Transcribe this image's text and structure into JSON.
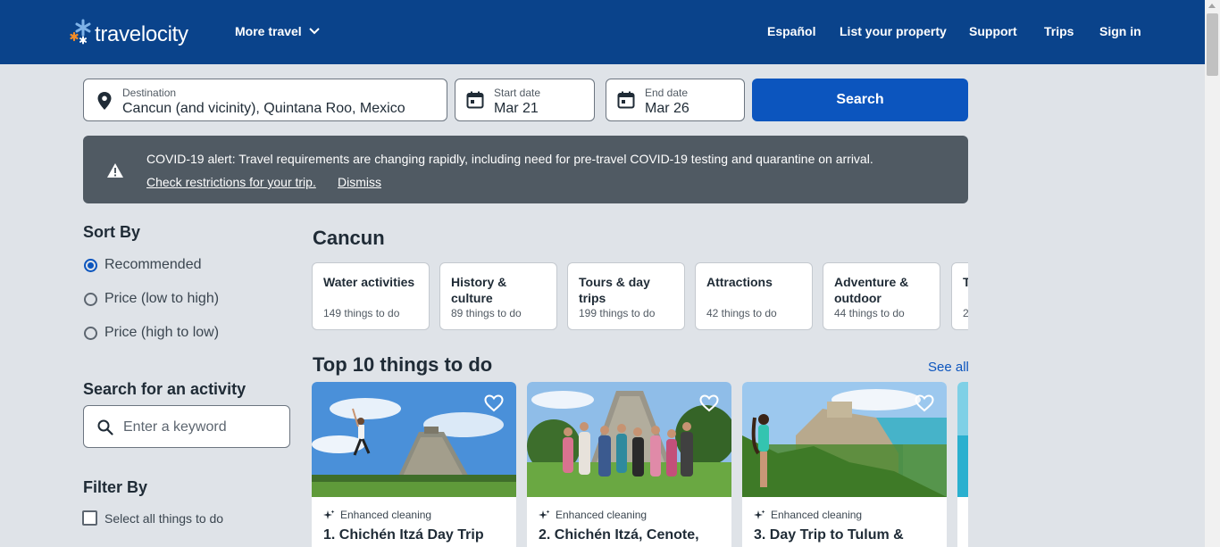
{
  "header": {
    "brand": "travelocity",
    "more_travel": "More travel",
    "links": [
      "Español",
      "List your property",
      "Support",
      "Trips",
      "Sign in"
    ]
  },
  "search": {
    "destination_label": "Destination",
    "destination_value": "Cancun (and vicinity), Quintana Roo, Mexico",
    "start_label": "Start date",
    "start_value": "Mar 21",
    "end_label": "End date",
    "end_value": "Mar 26",
    "button": "Search"
  },
  "alert": {
    "text": "COVID-19 alert: Travel requirements are changing rapidly, including need for pre-travel COVID-19 testing and quarantine on arrival.",
    "check_link": "Check restrictions for your trip.",
    "dismiss": "Dismiss"
  },
  "sidebar": {
    "sort_heading": "Sort By",
    "sort_options": [
      "Recommended",
      "Price (low to high)",
      "Price (high to low)"
    ],
    "sort_selected": "Recommended",
    "search_heading": "Search for an activity",
    "keyword_placeholder": "Enter a keyword",
    "filter_heading": "Filter By",
    "select_all": "Select all things to do"
  },
  "main": {
    "city": "Cancun",
    "categories": [
      {
        "name": "Water activities",
        "count": "149 things to do"
      },
      {
        "name": "History & culture",
        "count": "89 things to do"
      },
      {
        "name": "Tours & day trips",
        "count": "199 things to do"
      },
      {
        "name": "Attractions",
        "count": "42 things to do"
      },
      {
        "name": "Adventure & outdoor",
        "count": "44 things to do"
      },
      {
        "name": "T",
        "count": "2"
      }
    ],
    "top_heading": "Top 10 things to do",
    "see_all": "See all",
    "activities": [
      {
        "badge": "Enhanced cleaning",
        "title": "1. Chichén Itzá Day Trip"
      },
      {
        "badge": "Enhanced cleaning",
        "title": "2. Chichén Itzá, Cenote,"
      },
      {
        "badge": "Enhanced cleaning",
        "title": "3. Day Trip to Tulum &"
      }
    ]
  },
  "colors": {
    "header_bg": "#0a438b",
    "primary": "#0c55be",
    "alert_bg": "#505a63",
    "page_bg": "#dfe3e8"
  }
}
